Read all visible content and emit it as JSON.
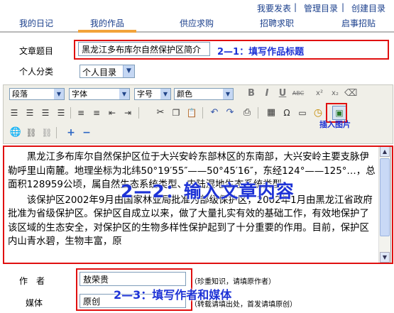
{
  "top_links": [
    {
      "label": "我要发表"
    },
    {
      "label": "管理目录"
    },
    {
      "label": "创建目录"
    }
  ],
  "top_link_sep": "|",
  "nav": {
    "tabs": [
      {
        "label": "我的日记"
      },
      {
        "label": "我的作品"
      },
      {
        "label": "供应求购"
      },
      {
        "label": "招聘求职"
      },
      {
        "label": "启事招贴"
      }
    ],
    "active_tab": "我的作品"
  },
  "form": {
    "title_label": "文章题目",
    "title_value": "黑龙江多布库尔自然保护区简介",
    "title_annotation": "2—1：填写作品标题",
    "category_label": "个人分类",
    "category_value": "个人目录",
    "author_label": "作　者",
    "author_value": "敖荣贵",
    "author_note": "（珍重知识，请填原作者）",
    "media_label": "媒体",
    "media_value": "原创",
    "media_note": "（转载请填出处，首发请填原创）",
    "author_media_annotation": "2—3：填写作者和媒体"
  },
  "toolbar": {
    "paragraph_select": "段落",
    "font_select": "字体",
    "size_select": "字号",
    "color_select": "颜色",
    "insert_image_annotation": "插入图片"
  },
  "editor": {
    "paragraphs": [
      "黑龙江多布库尔自然保护区位于大兴安岭东部林区的东南部，大兴安岭主要支脉伊勒呼里山南麓。地理坐标为北纬50°19′55″——50°45′16″，东经124°——125°…，总面积128959公顷，属自然生态系统类型、内陆湿地生态系统类型。",
      "该保护区2002年9月由国家林业局批准为部级保护区，2002年1月由黑龙江省政府批准为省级保护区。保护区自成立以来，做了大量扎实有效的基础工作，有效地保护了该区域的生态安全，对保护区的生物多样性保护起到了十分重要的作用。目前，保护区内山青水碧，生物丰富，原"
    ],
    "content_annotation": "2—2：输入文章内容"
  },
  "colors": {
    "link": "#1a3f8c",
    "annotation": "#1e33d6",
    "highlight_box": "#e01010",
    "active_tab": "#f2a33a"
  }
}
